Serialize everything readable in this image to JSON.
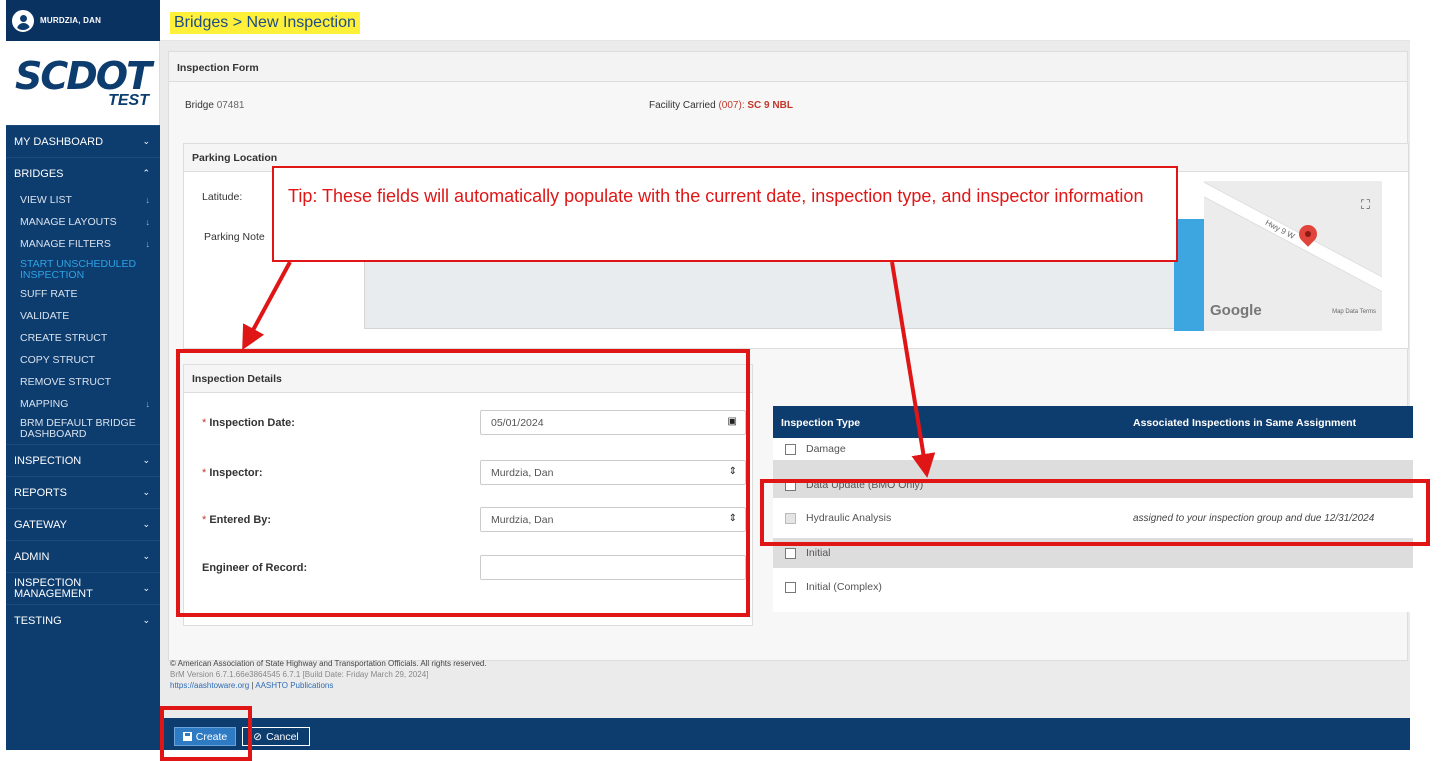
{
  "user": {
    "name": "MURDZIA, DAN"
  },
  "logo": {
    "main": "SCDOT",
    "sub": "TEST"
  },
  "breadcrumb": "Bridges > New Inspection",
  "nav": {
    "dashboard": "MY DASHBOARD",
    "bridges": "BRIDGES",
    "bridges_items": [
      "VIEW LIST",
      "MANAGE LAYOUTS",
      "MANAGE FILTERS",
      "START UNSCHEDULED INSPECTION",
      "SUFF RATE",
      "VALIDATE",
      "CREATE STRUCT",
      "COPY STRUCT",
      "REMOVE STRUCT",
      "MAPPING",
      "BRM DEFAULT BRIDGE DASHBOARD"
    ],
    "inspection": "INSPECTION",
    "reports": "REPORTS",
    "gateway": "GATEWAY",
    "admin": "ADMIN",
    "insp_mgmt": "INSPECTION MANAGEMENT",
    "testing": "TESTING"
  },
  "form": {
    "title": "Inspection Form",
    "bridge_label": "Bridge",
    "bridge_id": "07481",
    "facility_label": "Facility Carried",
    "facility_code": "(007):",
    "facility_road": "SC 9 NBL"
  },
  "parking": {
    "title": "Parking Location",
    "latitude_label": "Latitude:",
    "notes_label": "Parking Note",
    "map_road": "Hwy 9 W",
    "map_brand": "Google",
    "map_terms": "Map Data   Terms"
  },
  "details": {
    "title": "Inspection Details",
    "date_label": "Inspection Date:",
    "date_value": "05/01/2024",
    "inspector_label": "Inspector:",
    "inspector_value": "Murdzia, Dan",
    "entered_label": "Entered By:",
    "entered_value": "Murdzia, Dan",
    "eor_label": "Engineer of Record:",
    "eor_value": ""
  },
  "types": {
    "col1": "Inspection Type",
    "col2": "Associated Inspections in Same Assignment",
    "rows": [
      {
        "label": "Damage",
        "assoc": ""
      },
      {
        "label": "Data Update (BMO Only)",
        "assoc": ""
      },
      {
        "label": "Hydraulic Analysis",
        "assoc": "assigned to your inspection group and due 12/31/2024"
      },
      {
        "label": "Initial",
        "assoc": ""
      },
      {
        "label": "Initial (Complex)",
        "assoc": ""
      }
    ]
  },
  "footer": {
    "copyright": "© American Association of State Highway and Transportation Officials. All rights reserved.",
    "version": "BrM Version 6.7.1.66e3864545 6.7.1 [Build Date: Friday March 29, 2024]",
    "link1": "https://aashtoware.org",
    "sep": "|",
    "link2": "AASHTO Publications"
  },
  "actions": {
    "create": "Create",
    "cancel": "Cancel"
  },
  "tip": "Tip: These fields will automatically populate with the current date, inspection type, and inspector information",
  "colors": {
    "navy": "#0d3c6e",
    "annotation": "#e01616",
    "highlight": "#fff03a"
  }
}
